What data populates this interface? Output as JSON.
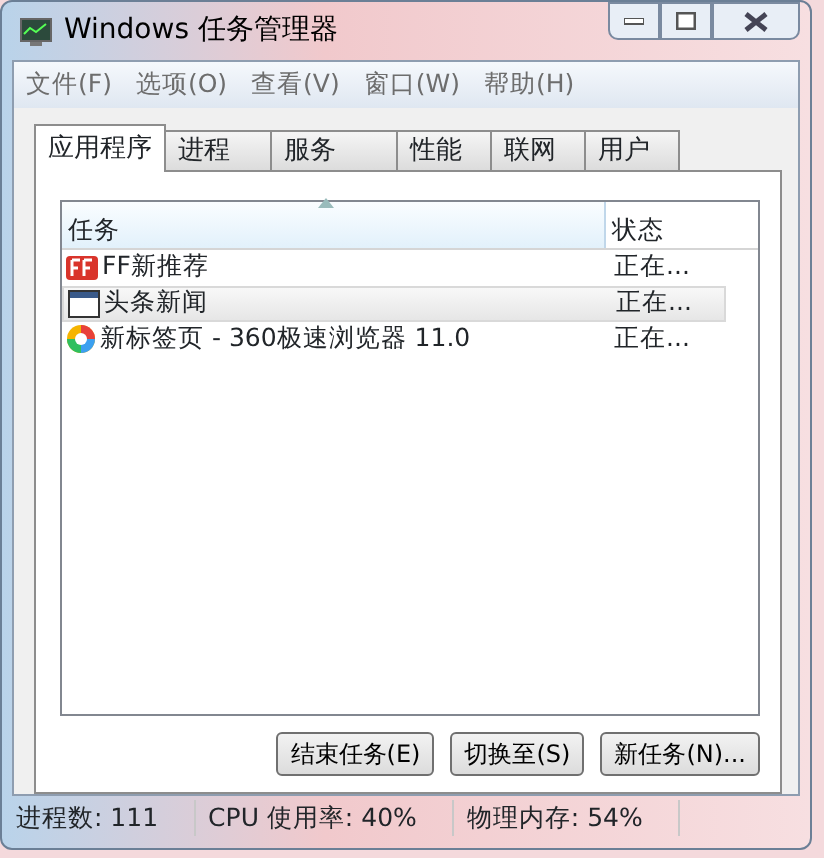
{
  "window": {
    "title": "Windows 任务管理器"
  },
  "menu": [
    "文件(F)",
    "选项(O)",
    "查看(V)",
    "窗口(W)",
    "帮助(H)"
  ],
  "tabs": [
    {
      "label": "应用程序",
      "selected": true
    },
    {
      "label": "进程",
      "selected": false
    },
    {
      "label": "服务",
      "selected": false
    },
    {
      "label": "性能",
      "selected": false
    },
    {
      "label": "联网",
      "selected": false
    },
    {
      "label": "用户",
      "selected": false
    }
  ],
  "table": {
    "columns": [
      "任务",
      "状态"
    ],
    "rows": [
      {
        "kind": "ff",
        "task": "FF新推荐",
        "status": "正在...",
        "selected": false
      },
      {
        "kind": "window",
        "task": "头条新闻",
        "status": "正在...",
        "selected": true
      },
      {
        "kind": "browser",
        "task": "新标签页 - 360极速浏览器 11.0",
        "status": "正在...",
        "selected": false
      }
    ]
  },
  "buttons": [
    "结束任务(E)",
    "切换至(S)",
    "新任务(N)..."
  ],
  "status_bar": [
    "进程数: 111",
    "CPU 使用率: 40%",
    "物理内存: 54%"
  ]
}
